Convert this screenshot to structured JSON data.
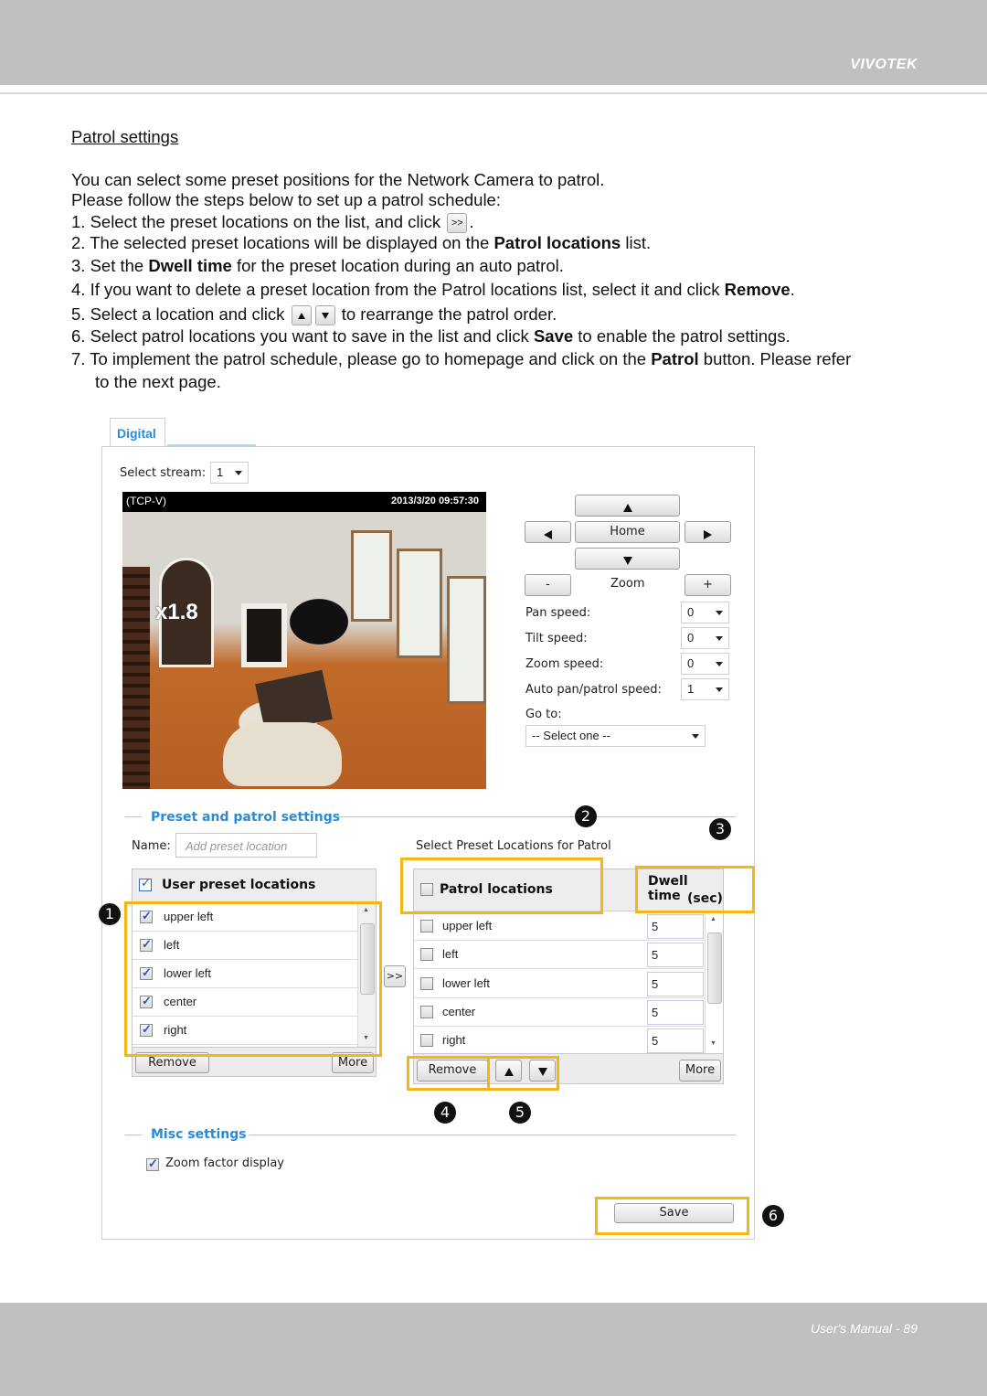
{
  "header": {
    "brand": "VIVOTEK"
  },
  "footer": {
    "page_label": "User's Manual - 89"
  },
  "document": {
    "section_title": "Patrol settings",
    "intro": [
      "You can select some preset positions for the Network Camera to patrol.",
      "Please follow the steps below to set up a patrol schedule:"
    ],
    "steps": {
      "s1_pre": "1. Select the preset locations on the list, and click",
      "s1_btn": ">>",
      "s1_post": ".",
      "s2_pre": "2. The selected preset locations will be displayed on the",
      "s2_bold": "Patrol locations",
      "s2_post": "list.",
      "s3_pre": "3. Set the",
      "s3_bold": "Dwell time",
      "s3_post": "for the preset location during an auto patrol.",
      "s4_pre": "4. If you want to delete a preset location from the Patrol locations list, select it and click",
      "s4_bold": "Remove",
      "s4_post": ".",
      "s5_pre": "5. Select a location and click",
      "s5_post": "to rearrange the patrol order.",
      "s6_pre": "6. Select patrol locations you want to save in the list and click",
      "s6_bold": "Save",
      "s6_post": "to enable the patrol settings.",
      "s7_pre": "7. To implement the patrol schedule, please go to homepage and click on the",
      "s7_bold": "Patrol",
      "s7_post": "button. Please refer",
      "s7_cont": "to the next page."
    }
  },
  "ui": {
    "tab_label": "Digital",
    "stream": {
      "label": "Select stream:",
      "value": "1"
    },
    "video": {
      "protocol": "(TCP-V)",
      "timestamp": "2013/3/20 09:57:30",
      "zoom_factor": "x1.8"
    },
    "ptz": {
      "home_label": "Home",
      "zoom_label": "Zoom",
      "zoom_out_label": "-",
      "zoom_in_label": "+",
      "pan_speed": {
        "label": "Pan speed:",
        "value": "0"
      },
      "tilt_speed": {
        "label": "Tilt speed:",
        "value": "0"
      },
      "zoom_speed": {
        "label": "Zoom speed:",
        "value": "0"
      },
      "auto_speed": {
        "label": "Auto pan/patrol speed:",
        "value": "1"
      },
      "goto": {
        "label": "Go to:",
        "value": "-- Select one --"
      }
    },
    "preset_section": {
      "title": "Preset and patrol settings",
      "name_label": "Name:",
      "name_placeholder": "Add preset location",
      "patrol_caption": "Select Preset Locations for Patrol",
      "user_list": {
        "header": "User preset locations",
        "items": [
          {
            "label": "upper left",
            "checked": true
          },
          {
            "label": "left",
            "checked": true
          },
          {
            "label": "lower left",
            "checked": true
          },
          {
            "label": "center",
            "checked": true
          },
          {
            "label": "right",
            "checked": true
          }
        ],
        "remove_label": "Remove",
        "more_label": "More"
      },
      "add_button": ">>",
      "patrol_list": {
        "header": "Patrol locations",
        "dwell_header_1": "Dwell time",
        "dwell_header_2": "(sec)",
        "items": [
          {
            "label": "upper left",
            "dwell": "5",
            "checked": false
          },
          {
            "label": "left",
            "dwell": "5",
            "checked": false
          },
          {
            "label": "lower left",
            "dwell": "5",
            "checked": false
          },
          {
            "label": "center",
            "dwell": "5",
            "checked": false
          },
          {
            "label": "right",
            "dwell": "5",
            "checked": false
          }
        ],
        "remove_label": "Remove",
        "more_label": "More"
      }
    },
    "misc_section": {
      "title": "Misc settings",
      "zoom_factor_display": {
        "label": "Zoom factor display",
        "checked": true
      }
    },
    "save_label": "Save",
    "callouts": [
      "1",
      "2",
      "3",
      "4",
      "5",
      "6"
    ],
    "highlight_color": "#f7b515",
    "accent_color": "#2b8ad6"
  }
}
